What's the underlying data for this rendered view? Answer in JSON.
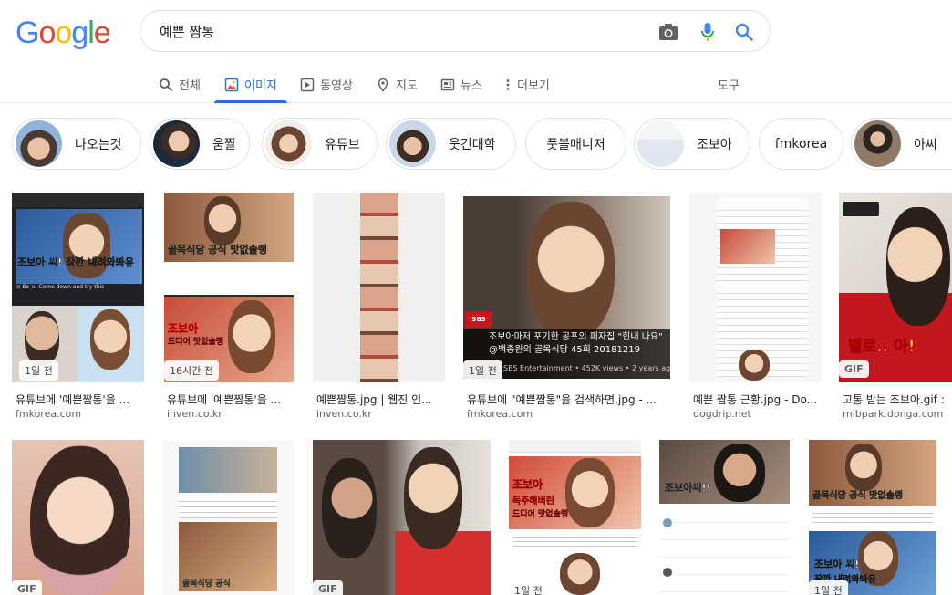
{
  "logo": {
    "letters": [
      "G",
      "o",
      "o",
      "g",
      "l",
      "e"
    ]
  },
  "search": {
    "query": "예쁜 짬통"
  },
  "tabs": [
    {
      "label": "전체",
      "icon": "search-icon"
    },
    {
      "label": "이미지",
      "icon": "image-icon",
      "active": true
    },
    {
      "label": "동영상",
      "icon": "video-icon"
    },
    {
      "label": "지도",
      "icon": "map-pin-icon"
    },
    {
      "label": "뉴스",
      "icon": "news-icon"
    },
    {
      "label": "더보기",
      "icon": "more-vert-icon"
    }
  ],
  "tools_label": "도구",
  "chips": [
    "나오는것",
    "움짤",
    "유튜브",
    "웃긴대학",
    "풋볼매니저",
    "조보아",
    "fmkorea",
    "아씨"
  ],
  "row1": [
    {
      "title": "유튜브에 '예쁜짬통'을 ...",
      "site": "fmkorea.com",
      "badge": "1일 전",
      "overlay": "조보아 씨!\n잠깐 내려와봐유",
      "caption": "Jo Bo-a! Come down and try this"
    },
    {
      "title": "유튜브에 '예쁜짬통'을 ...",
      "site": "inven.co.kr",
      "badge": "16시간 전",
      "overlay": "골목식당 공식 맛없솔랭",
      "caption": "조보아",
      "caption2": "드디어 맛없솔랭"
    },
    {
      "title": "예쁜짬통.jpg | 웹진 인...",
      "site": "inven.co.kr"
    },
    {
      "title": "유튜브에 \"예쁜짬통\"을 검색하면.jpg - ...",
      "site": "fmkorea.com",
      "badge": "1일 전",
      "caption": "조보아마저 포기한 공포의 피자집 \"힌내 나요\" @백종원의 골목식당 45회 20181219",
      "sub": "SBS Entertainment • 452K views • 2 years ago"
    },
    {
      "title": "예쁜 짬통 근황.jpg - Do...",
      "site": "dogdrip.net"
    },
    {
      "title": "고통 받는 조보아.gif :",
      "site": "mlbpark.donga.com",
      "badge": "GIF",
      "overlay": "별로.. 아!"
    }
  ],
  "row2": [
    {
      "badge": "GIF"
    },
    {
      "caption": "골목식당 공식"
    },
    {
      "badge": "GIF"
    },
    {
      "badge": "1일 전",
      "overlay": "조보아",
      "caption": "독주해버린",
      "caption2": "드디어 맛없솔랭"
    },
    {
      "overlay": "조보아씨!!"
    },
    {
      "badge": "1일 전",
      "overlay": "골목식당 공식 맛없솔랭",
      "caption": "조보아 씨!",
      "caption2": "잠깐 내려와봐유"
    }
  ]
}
